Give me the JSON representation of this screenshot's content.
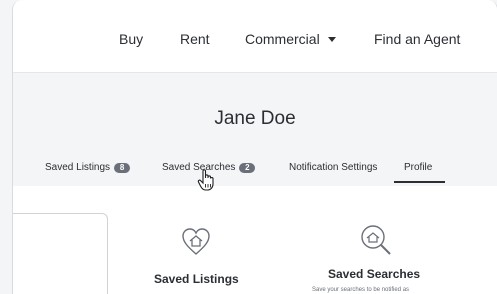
{
  "nav": {
    "items": [
      {
        "label": "Buy",
        "has_dropdown": false
      },
      {
        "label": "Rent",
        "has_dropdown": false
      },
      {
        "label": "Commercial",
        "has_dropdown": true
      },
      {
        "label": "Find an Agent",
        "has_dropdown": false
      }
    ]
  },
  "profile": {
    "name": "Jane Doe"
  },
  "tabs": [
    {
      "label": "Saved Listings",
      "count": "8",
      "active": false
    },
    {
      "label": "Saved Searches",
      "count": "2",
      "active": false
    },
    {
      "label": "Notification Settings",
      "active": false
    },
    {
      "label": "Profile",
      "active": true
    }
  ],
  "cards": [
    {
      "title": "Saved Listings",
      "icon": "heart-house-icon"
    },
    {
      "title": "Saved Searches",
      "icon": "magnifier-house-icon",
      "description": "Save your searches to be notified as"
    }
  ],
  "colors": {
    "text": "#2b2f33",
    "badge": "#6a6f79",
    "band": "#f4f5f7"
  }
}
